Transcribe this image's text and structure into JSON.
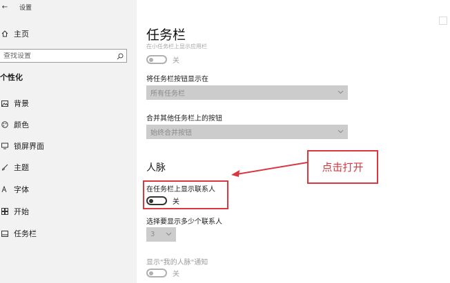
{
  "window": {
    "back_glyph": "←",
    "title": "设置"
  },
  "sidebar": {
    "home_label": "主页",
    "search_placeholder": "查找设置",
    "section": "个性化",
    "items": [
      {
        "label": "背景",
        "icon": "picture-icon"
      },
      {
        "label": "颜色",
        "icon": "palette-icon"
      },
      {
        "label": "锁屏界面",
        "icon": "lock-screen-icon"
      },
      {
        "label": "主题",
        "icon": "brush-icon"
      },
      {
        "label": "字体",
        "icon": "font-icon"
      },
      {
        "label": "开始",
        "icon": "start-icon"
      },
      {
        "label": "任务栏",
        "icon": "taskbar-icon"
      }
    ]
  },
  "main": {
    "title": "任务栏",
    "faded_setting": "在小任务栏上显示应用栏",
    "toggle1_state": "关",
    "position_label": "将任务栏按钮显示在",
    "position_value": "所有任务栏",
    "combine_label": "合并其他任务栏上的按钮",
    "combine_value": "始终合并按钮",
    "people_title": "人脉",
    "people_show_label": "在任务栏上显示联系人",
    "people_show_state": "关",
    "contacts_count_label": "选择要显示多少个联系人",
    "contacts_count_value": "3",
    "notify_label": "显示\"我的人脉\"通知",
    "notify_state": "关"
  },
  "annotation": {
    "callout_text": "点击打开",
    "accent": "#d9363e"
  }
}
